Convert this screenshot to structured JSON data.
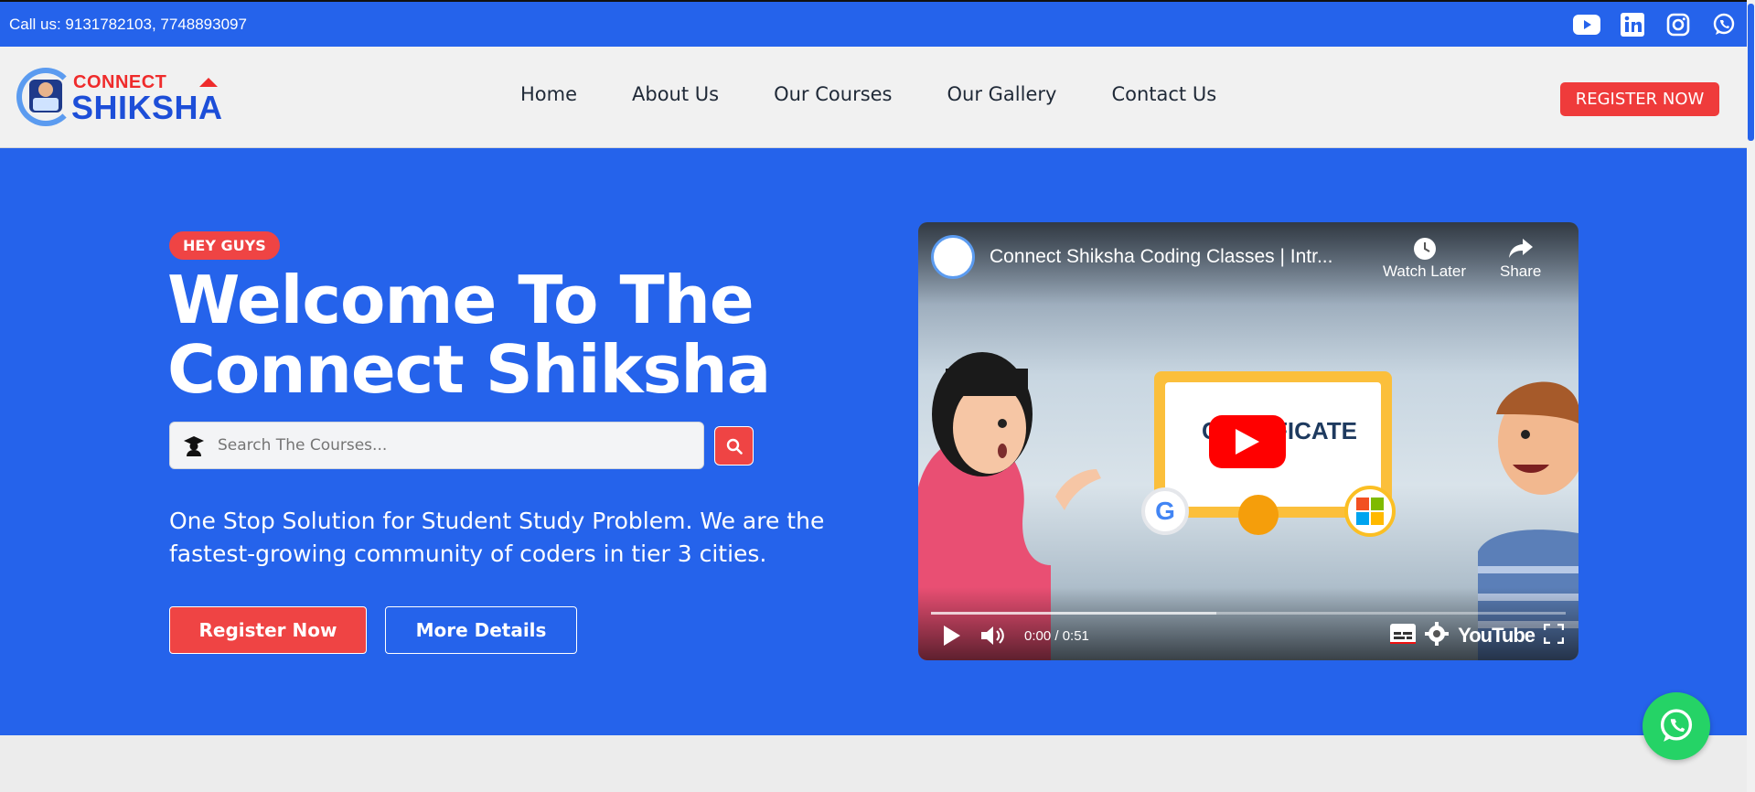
{
  "topbar": {
    "call_text": "Call us: 9131782103, 7748893097",
    "socials": [
      "youtube-icon",
      "linkedin-icon",
      "instagram-icon",
      "whatsapp-icon"
    ]
  },
  "brand": {
    "word1": "CONNECT",
    "word2": "SHIKSHA",
    "colors": {
      "blue": "#2563eb",
      "red": "#ef4444",
      "green": "#25d366"
    }
  },
  "nav": {
    "items": [
      "Home",
      "About Us",
      "Our Courses",
      "Our Gallery",
      "Contact Us"
    ],
    "register_label": "REGISTER NOW"
  },
  "hero": {
    "badge": "HEY GUYS",
    "headline_line1": "Welcome To The",
    "headline_line2": "Connect Shiksha",
    "search_placeholder": "Search The Courses...",
    "description": "One Stop Solution for Student Study Problem. We are the fastest-growing community of coders in tier 3 cities.",
    "register_label": "Register Now",
    "more_label": "More Details"
  },
  "video": {
    "title": "Connect Shiksha Coding Classes | Intr...",
    "watch_later": "Watch Later",
    "share": "Share",
    "cert_word": "CERTIFICATE",
    "time": "0:00 / 0:51",
    "brand": "YouTube",
    "buffered_fraction": 0.45
  }
}
